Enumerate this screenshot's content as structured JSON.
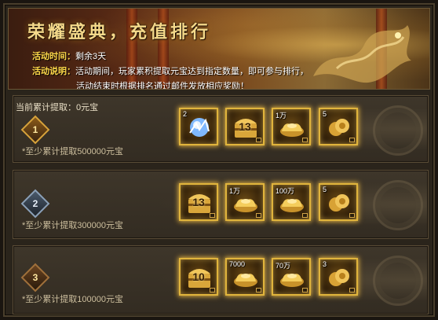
{
  "banner": {
    "title": "荣耀盛典，充值排行",
    "time_key": "活动时间：",
    "time_value": "剩余3天",
    "desc_key": "活动说明：",
    "desc_line1": "活动期间，玩家累积提取元宝达到指定数量，即可参与排行，",
    "desc_line2": "活动结束时根据排名通过邮件发放相应奖励！"
  },
  "total_withdrawn": "当前累计提取：0元宝",
  "ranks": [
    {
      "rank": "1",
      "requirement": "*至少累计提取500000元宝",
      "rewards": [
        {
          "icon": "blue-orb-icon",
          "count": "2",
          "big": "",
          "locked": false
        },
        {
          "icon": "treasure-chest-icon",
          "count": "",
          "big": "13",
          "locked": true
        },
        {
          "icon": "gold-ingot-icon",
          "count": "1万",
          "big": "",
          "locked": true
        },
        {
          "icon": "gold-coin-pile-icon",
          "count": "5",
          "big": "",
          "locked": true
        }
      ]
    },
    {
      "rank": "2",
      "requirement": "*至少累计提取300000元宝",
      "rewards": [
        {
          "icon": "treasure-chest-icon",
          "count": "",
          "big": "13",
          "locked": true
        },
        {
          "icon": "gold-ingot-icon",
          "count": "1万",
          "big": "",
          "locked": true
        },
        {
          "icon": "gold-ingot-icon",
          "count": "100万",
          "big": "",
          "locked": true
        },
        {
          "icon": "gold-coin-pile-icon",
          "count": "5",
          "big": "",
          "locked": true
        }
      ]
    },
    {
      "rank": "3",
      "requirement": "*至少累计提取100000元宝",
      "rewards": [
        {
          "icon": "treasure-chest-icon",
          "count": "",
          "big": "10",
          "locked": true
        },
        {
          "icon": "gold-ingot-icon",
          "count": "7000",
          "big": "",
          "locked": true
        },
        {
          "icon": "gold-ingot-icon",
          "count": "70万",
          "big": "",
          "locked": true
        },
        {
          "icon": "gold-coin-pile-icon",
          "count": "3",
          "big": "",
          "locked": true
        }
      ]
    }
  ],
  "colors": {
    "accent_gold": "#e0b43c",
    "title_gold": "#f4d98a",
    "key_yellow": "#ffd94a"
  }
}
